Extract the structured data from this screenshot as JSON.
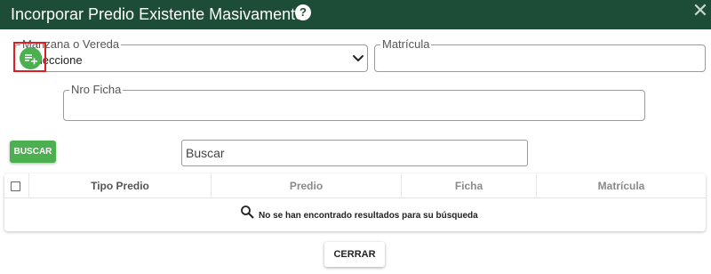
{
  "dialog": {
    "title": "Incorporar Predio Existente Masivamente",
    "header_color": "#1e4d37",
    "help_icon": "question-circle-icon",
    "close_icon": "close-x-icon"
  },
  "form": {
    "manzana_label": "Manzana o Vereda",
    "manzana_value": "Seleccione",
    "matricula_label": "Matrícula",
    "matricula_value": "",
    "nro_ficha_label": "Nro Ficha",
    "nro_ficha_value": "",
    "add_icon": "playlist-add-icon",
    "add_icon_color": "#4caf50"
  },
  "search": {
    "button_label": "BUSCAR",
    "input_placeholder": "Buscar",
    "button_color": "#4caf50"
  },
  "table": {
    "columns": [
      "Tipo Predio",
      "Predio",
      "Ficha",
      "Matrícula"
    ],
    "empty_message": "No se han encontrado resultados para su búsqueda",
    "empty_icon": "search-icon"
  },
  "footer": {
    "close_label": "CERRAR"
  }
}
